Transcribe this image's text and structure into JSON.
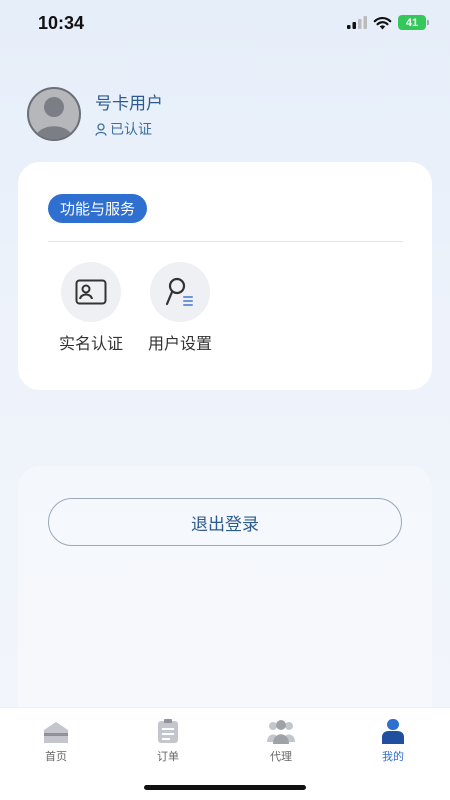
{
  "status_bar": {
    "time": "10:34",
    "battery": "41"
  },
  "profile": {
    "username": "号卡用户",
    "verified_label": "已认证"
  },
  "services": {
    "section_title": "功能与服务",
    "items": [
      {
        "label": "实名认证",
        "icon": "id-card-icon"
      },
      {
        "label": "用户设置",
        "icon": "user-settings-icon"
      }
    ]
  },
  "logout": {
    "label": "退出登录"
  },
  "tabbar": {
    "active": "我的",
    "items": [
      {
        "label": "首页",
        "icon": "home-icon"
      },
      {
        "label": "订单",
        "icon": "order-icon"
      },
      {
        "label": "代理",
        "icon": "agent-icon"
      },
      {
        "label": "我的",
        "icon": "profile-icon"
      }
    ]
  },
  "colors": {
    "accent": "#2f6fd0",
    "text_blue": "#2d5b8f",
    "battery": "#34c759"
  }
}
